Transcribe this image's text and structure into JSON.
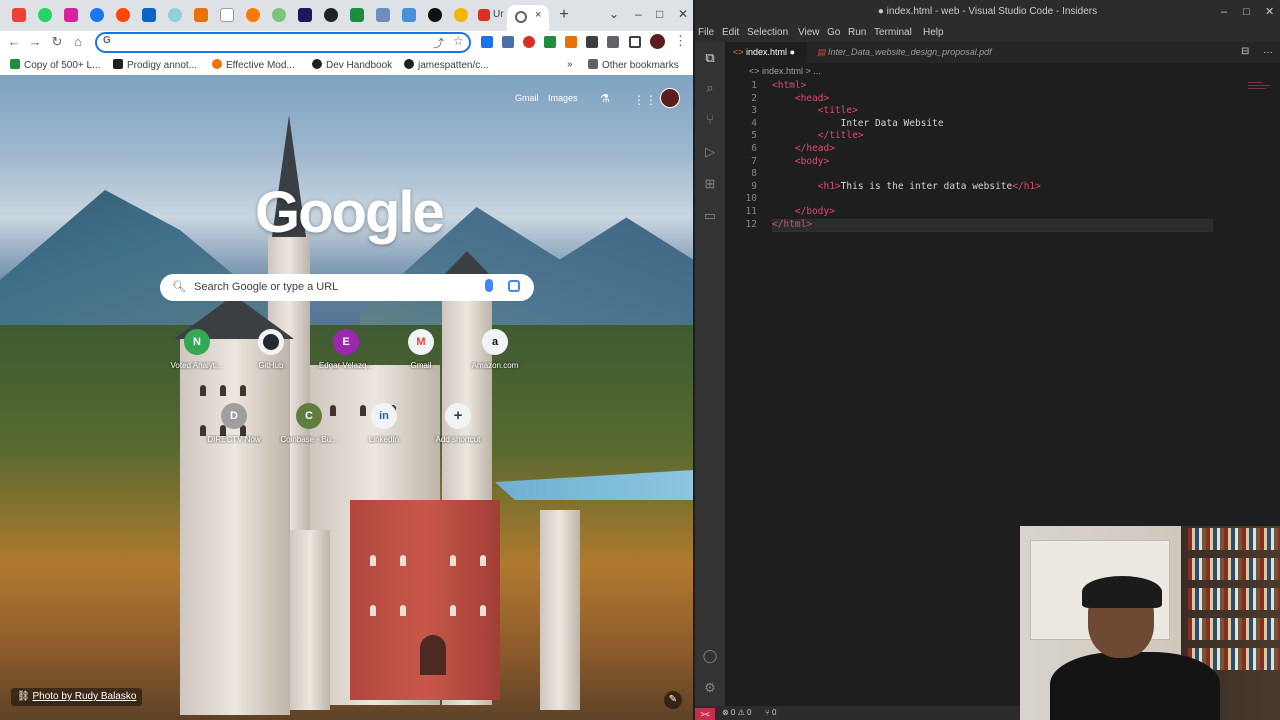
{
  "chrome": {
    "tabs": {
      "active_tab_label": "",
      "partial_tab_label": "Ur",
      "new_tab_symbol": "+",
      "close_symbol": "×"
    },
    "window_controls": {
      "dropdown": "⌄",
      "minimize": "–",
      "maximize": "□",
      "close": "✕"
    },
    "omnibox": {
      "value": "",
      "search_engine_glyph": "G"
    },
    "bookmarks": [
      {
        "label": "Copy of 500+ L...",
        "color": "#1e8e3e"
      },
      {
        "label": "Prodigy annot...",
        "color": "#202124"
      },
      {
        "label": "Effective Mod...",
        "color": "#e8710a"
      },
      {
        "label": "Dev Handbook",
        "color": "#202124"
      },
      {
        "label": "jamespatten/c...",
        "color": "#202124"
      }
    ],
    "bookmarks_overflow": "»",
    "other_bookmarks": "Other bookmarks"
  },
  "ntp": {
    "top_links": {
      "gmail": "Gmail",
      "images": "Images"
    },
    "logo_text": "Google",
    "search_placeholder": "Search Google or type a URL",
    "shortcuts": [
      {
        "letter": "N",
        "label": "Voted Analyti...",
        "color": "#34a853"
      },
      {
        "letter": "",
        "label": "GitHub",
        "color": "#f1f3f4"
      },
      {
        "letter": "E",
        "label": "Edgar Velazq...",
        "color": "#9c27b0"
      },
      {
        "letter": "M",
        "label": "Gmail",
        "color": "#f1f3f4"
      },
      {
        "letter": "a",
        "label": "Amazon.com",
        "color": "#f1f3f4"
      },
      {
        "letter": "D",
        "label": "DIRECTV Now",
        "color": "#9e9e9e"
      },
      {
        "letter": "C",
        "label": "Coinbase - Bu...",
        "color": "#5f7d3e"
      },
      {
        "letter": "in",
        "label": "LinkedIn",
        "color": "#f1f3f4"
      },
      {
        "letter": "+",
        "label": "Add shortcut",
        "color": "#f1f3f4"
      }
    ],
    "photo_credit": "Photo by Rudy Balasko"
  },
  "vscode": {
    "title": "● index.html - web - Visual Studio Code - Insiders",
    "menu": [
      "File",
      "Edit",
      "Selection",
      "View",
      "Go",
      "Run",
      "Terminal",
      "Help"
    ],
    "tabs": [
      {
        "label": "index.html",
        "modified": "●"
      },
      {
        "label": "Inter_Data_website_design_proposal.pdf"
      }
    ],
    "breadcrumb": "<> index.html > ...",
    "code_lines": [
      {
        "n": "1",
        "text": "<html>"
      },
      {
        "n": "2",
        "text": "    <head>"
      },
      {
        "n": "3",
        "text": "        <title>"
      },
      {
        "n": "4",
        "text": "            Inter Data Website"
      },
      {
        "n": "5",
        "text": "        </title>"
      },
      {
        "n": "6",
        "text": "    </head>"
      },
      {
        "n": "7",
        "text": "    <body>"
      },
      {
        "n": "8",
        "text": ""
      },
      {
        "n": "9",
        "text": "        <h1>This is the inter data website</h1>"
      },
      {
        "n": "10",
        "text": ""
      },
      {
        "n": "11",
        "text": "    </body>"
      },
      {
        "n": "12",
        "text": "</html>"
      }
    ],
    "status": {
      "remote": "><",
      "errors": "⊗ 0 ⚠ 0",
      "ports": "⑂ 0"
    }
  }
}
